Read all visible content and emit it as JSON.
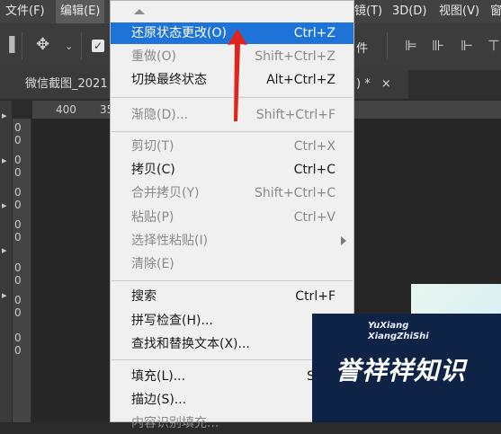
{
  "menubar": {
    "items": [
      "文件(F)",
      "编辑(E)",
      "镜(T)",
      "3D(D)",
      "视图(V)",
      "窗"
    ]
  },
  "optionsbar": {
    "partial_label": "件"
  },
  "tabs": {
    "doc_tab": "微信截图_2021",
    "doc_tab_right": ") *",
    "close_glyph": "×"
  },
  "ruler": {
    "h_labels": [
      "400",
      "35"
    ],
    "v_labels": [
      "0",
      "0",
      "0",
      "0",
      "0",
      "0",
      "0",
      "0",
      "0",
      "0",
      "0",
      "0",
      "0",
      "0"
    ]
  },
  "edit_menu": {
    "items": [
      {
        "label": "还原状态更改(O)",
        "shortcut": "Ctrl+Z"
      },
      {
        "label": "重做(O)",
        "shortcut": "Shift+Ctrl+Z"
      },
      {
        "label": "切换最终状态",
        "shortcut": "Alt+Ctrl+Z"
      },
      {
        "label": "渐隐(D)...",
        "shortcut": "Shift+Ctrl+F"
      },
      {
        "label": "剪切(T)",
        "shortcut": "Ctrl+X"
      },
      {
        "label": "拷贝(C)",
        "shortcut": "Ctrl+C"
      },
      {
        "label": "合并拷贝(Y)",
        "shortcut": "Shift+Ctrl+C"
      },
      {
        "label": "粘贴(P)",
        "shortcut": "Ctrl+V"
      },
      {
        "label": "选择性粘贴(I)",
        "shortcut": ""
      },
      {
        "label": "清除(E)",
        "shortcut": ""
      },
      {
        "label": "搜索",
        "shortcut": "Ctrl+F"
      },
      {
        "label": "拼写检查(H)...",
        "shortcut": ""
      },
      {
        "label": "查找和替换文本(X)...",
        "shortcut": ""
      },
      {
        "label": "填充(L)...",
        "shortcut": "Shift"
      },
      {
        "label": "描边(S)...",
        "shortcut": ""
      },
      {
        "label": "内容识别填充...",
        "shortcut": ""
      }
    ]
  },
  "watermark": {
    "en_line1": "YuXiang",
    "en_line2": "XiangZhiShi",
    "cn": "誉祥祥知识"
  },
  "colors": {
    "highlight": "#1e73d8",
    "annotation_arrow": "#e0241b"
  }
}
